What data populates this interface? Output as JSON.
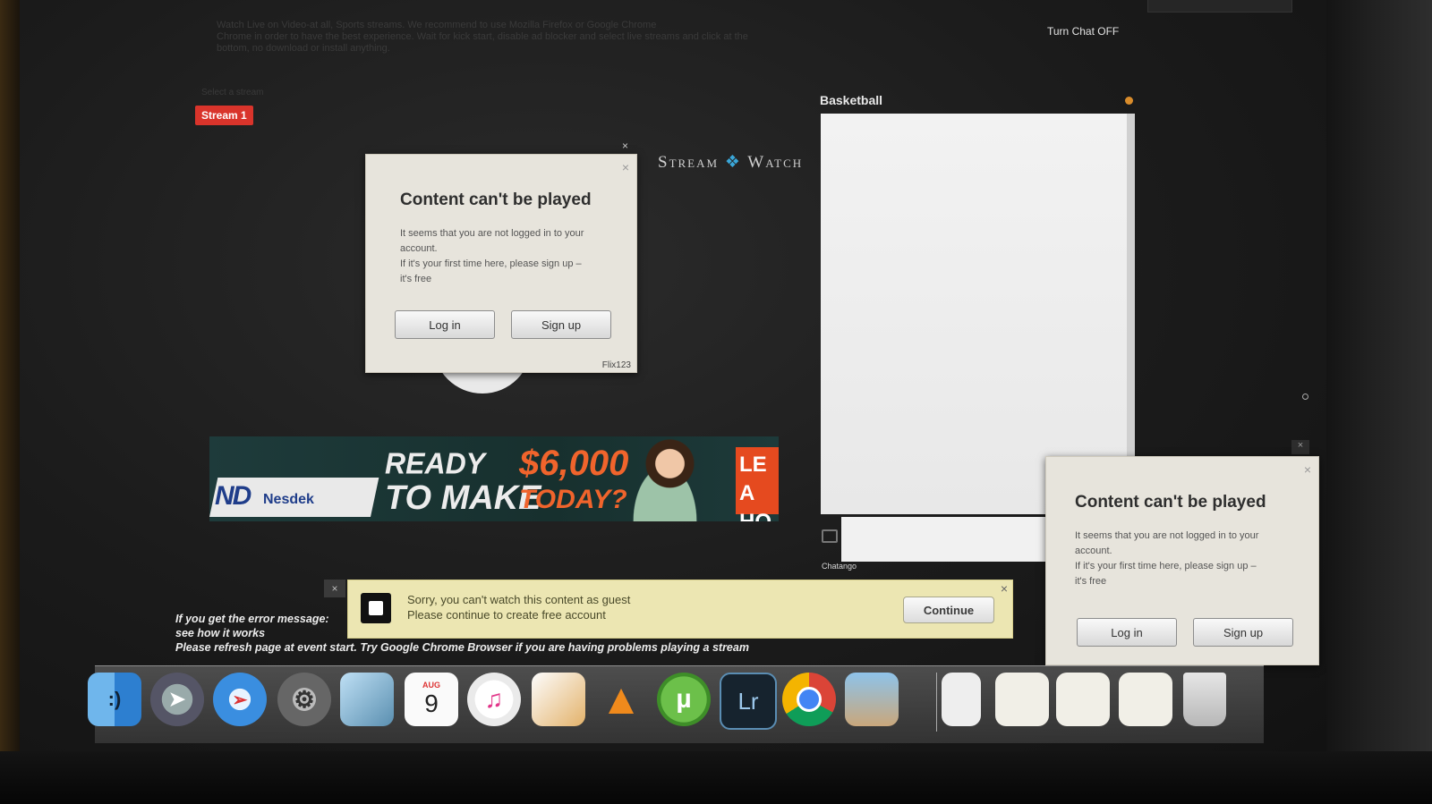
{
  "page": {
    "notice_line1": "Watch Live on Video-at all, Sports streams. We recommend to use Mozilla Firefox or Google Chrome",
    "notice_line2": "Chrome in order to have the best experience. Wait for kick start, disable ad blocker and select live streams and click at the",
    "notice_line3": "bottom, no download or install anything.",
    "faded_label": "Select a stream",
    "turn_chat_label": "Turn Chat OFF",
    "stream_tab_label": "Stream 1",
    "logo_left": "Stream",
    "logo_right": "Watch"
  },
  "dialog_main": {
    "title": "Content can't be played",
    "body_line1": "It seems that you are not logged in to your",
    "body_line2": "account.",
    "body_line3": "If it's your first time here, please sign up –",
    "body_line4": "it's free",
    "login_label": "Log in",
    "signup_label": "Sign up",
    "brand": "Flix123",
    "close_symbol": "×"
  },
  "dialog_side": {
    "title": "Content can't be played",
    "body_line1": "It seems that you are not logged in to your",
    "body_line2": "account.",
    "body_line3": "If it's your first time here, please sign up –",
    "body_line4": "it's free",
    "login_label": "Log in",
    "signup_label": "Sign up",
    "close_symbol": "×"
  },
  "ad": {
    "logo_big": "ND",
    "logo_small": "Nesdek",
    "line1": "READY",
    "line2": "TO MAKE",
    "amount": "$6,000",
    "today": "TODAY?",
    "cta": "LEA HO"
  },
  "chat": {
    "title": "Basketball",
    "footer": "Chatango"
  },
  "error": {
    "line1": "If you get the error message:",
    "line2": "see how it works",
    "line3": "Please refresh page at event start. Try Google Chrome Browser if you are having problems playing a stream",
    "close_symbol": "×"
  },
  "guest_bar": {
    "line1": "Sorry, you can't watch this content as guest",
    "line2": "Please continue to create free account",
    "continue_label": "Continue",
    "close_symbol": "×"
  },
  "dock": {
    "calendar_month": "AUG",
    "calendar_day": "9",
    "lightroom_label": "Lr",
    "items": [
      "Finder",
      "Launchpad",
      "Safari",
      "System Preferences",
      "Preview",
      "Calendar",
      "iTunes",
      "Pages",
      "VLC",
      "uTorrent",
      "Lightroom",
      "Chrome",
      "iPhoto",
      "Archive",
      "Document",
      "Document",
      "Document",
      "Trash"
    ]
  },
  "colors": {
    "stream_tab": "#d9342b",
    "ad_orange": "#f0642c",
    "dialog_bg": "#e7e4dc",
    "guest_bar_bg": "#ece6b2"
  }
}
